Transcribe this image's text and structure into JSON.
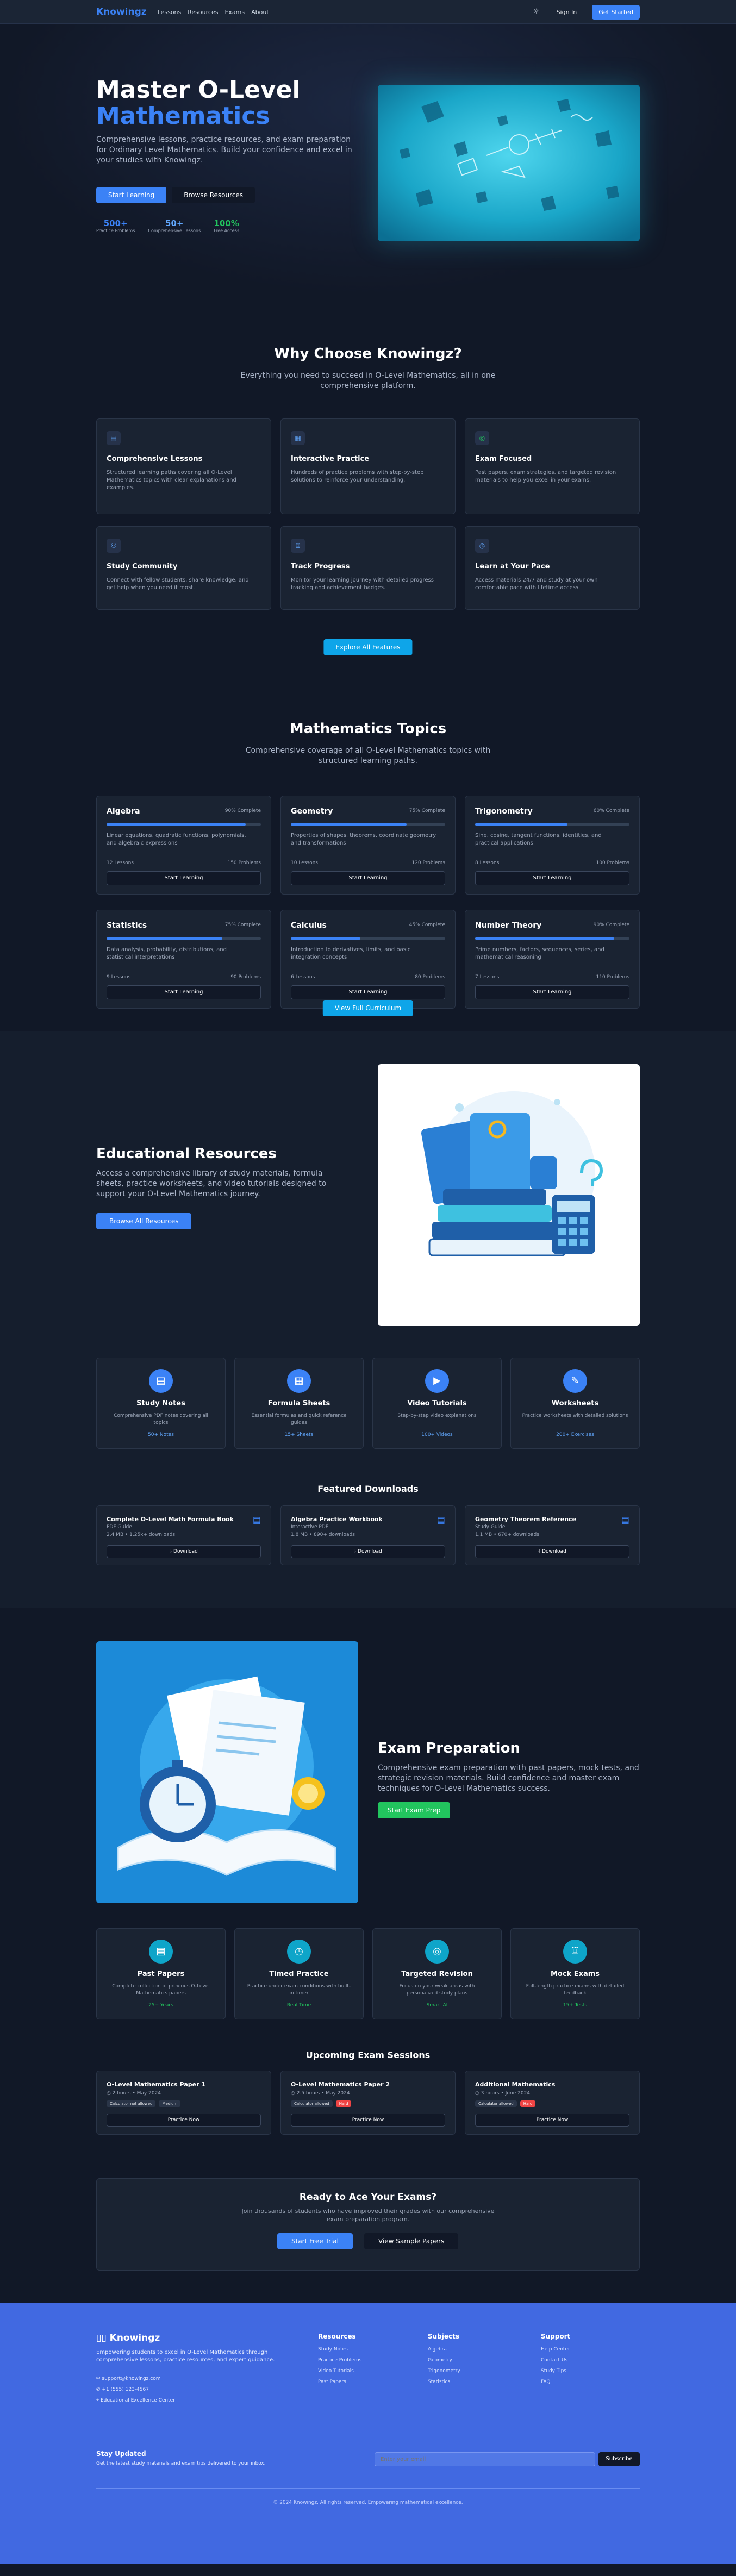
{
  "nav": {
    "logo": "Knowingz",
    "links": [
      "Lessons",
      "Resources",
      "Exams",
      "About"
    ],
    "theme_icon": "sun-icon",
    "signin": "Sign In",
    "get_started": "Get Started"
  },
  "hero": {
    "title_line1": "Master O-Level",
    "title_line2": "Mathematics",
    "subtitle": "Comprehensive lessons, practice resources, and exam preparation for Ordinary Level Mathematics. Build your confidence and excel in your studies with Knowingz.",
    "btn_primary": "Start Learning",
    "btn_secondary": "Browse Resources",
    "stats": [
      {
        "value": "500+",
        "label": "Practice Problems",
        "color": "#3b82f6"
      },
      {
        "value": "50+",
        "label": "Comprehensive Lessons",
        "color": "#60a5fa"
      },
      {
        "value": "100%",
        "label": "Free Access",
        "color": "#22c55e"
      }
    ]
  },
  "why": {
    "title": "Why Choose Knowingz?",
    "lead": "Everything you need to succeed in O-Level Mathematics, all in one comprehensive platform.",
    "features": [
      {
        "icon": "book-icon",
        "title": "Comprehensive Lessons",
        "text": "Structured learning paths covering all O-Level Mathematics topics with clear explanations and examples."
      },
      {
        "icon": "calculator-icon",
        "title": "Interactive Practice",
        "text": "Hundreds of practice problems with step-by-step solutions to reinforce your understanding."
      },
      {
        "icon": "target-icon",
        "title": "Exam Focused",
        "text": "Past papers, exam strategies, and targeted revision materials to help you excel in your exams."
      },
      {
        "icon": "users-icon",
        "title": "Study Community",
        "text": "Connect with fellow students, share knowledge, and get help when you need it most."
      },
      {
        "icon": "trophy-icon",
        "title": "Track Progress",
        "text": "Monitor your learning journey with detailed progress tracking and achievement badges."
      },
      {
        "icon": "clock-icon",
        "title": "Learn at Your Pace",
        "text": "Access materials 24/7 and study at your own comfortable pace with lifetime access."
      }
    ],
    "button": "Explore All Features"
  },
  "topics": {
    "title": "Mathematics Topics",
    "lead": "Comprehensive coverage of all O-Level Mathematics topics with structured learning paths.",
    "items": [
      {
        "name": "Algebra",
        "pct_label": "90% Complete",
        "pct": 0.9,
        "desc": "Linear equations, quadratic functions, polynomials, and algebraic expressions",
        "lessons": "12 Lessons",
        "problems": "150 Problems",
        "btn": "Start Learning"
      },
      {
        "name": "Geometry",
        "pct_label": "75% Complete",
        "pct": 0.75,
        "desc": "Properties of shapes, theorems, coordinate geometry and transformations",
        "lessons": "10 Lessons",
        "problems": "120 Problems",
        "btn": "Start Learning"
      },
      {
        "name": "Trigonometry",
        "pct_label": "60% Complete",
        "pct": 0.6,
        "desc": "Sine, cosine, tangent functions, identities, and practical applications",
        "lessons": "8 Lessons",
        "problems": "100 Problems",
        "btn": "Start Learning"
      },
      {
        "name": "Statistics",
        "pct_label": "75% Complete",
        "pct": 0.75,
        "desc": "Data analysis, probability, distributions, and statistical interpretations",
        "lessons": "9 Lessons",
        "problems": "90 Problems",
        "btn": "Start Learning"
      },
      {
        "name": "Calculus",
        "pct_label": "45% Complete",
        "pct": 0.45,
        "desc": "Introduction to derivatives, limits, and basic integration concepts",
        "lessons": "6 Lessons",
        "problems": "80 Problems",
        "btn": "Start Learning"
      },
      {
        "name": "Number Theory",
        "pct_label": "90% Complete",
        "pct": 0.9,
        "desc": "Prime numbers, factors, sequences, series, and mathematical reasoning",
        "lessons": "7 Lessons",
        "problems": "110 Problems",
        "btn": "Start Learning"
      }
    ],
    "button": "View Full Curriculum"
  },
  "resources": {
    "title": "Educational Resources",
    "lead": "Access a comprehensive library of study materials, formula sheets, practice worksheets, and video tutorials designed to support your O-Level Mathematics journey.",
    "button": "Browse All Resources",
    "cards": [
      {
        "icon": "file-icon",
        "title": "Study Notes",
        "text": "Comprehensive PDF notes covering all topics",
        "count": "50+ Notes"
      },
      {
        "icon": "calculator-icon",
        "title": "Formula Sheets",
        "text": "Essential formulas and quick reference guides",
        "count": "15+ Sheets"
      },
      {
        "icon": "video-icon",
        "title": "Video Tutorials",
        "text": "Step-by-step video explanations",
        "count": "100+ Videos"
      },
      {
        "icon": "pencil-icon",
        "title": "Worksheets",
        "text": "Practice worksheets with detailed solutions",
        "count": "200+ Exercises"
      }
    ],
    "downloads_title": "Featured Downloads",
    "downloads": [
      {
        "title": "Complete O-Level Math Formula Book",
        "type": "PDF Guide",
        "meta": "2.4 MB • 1.25k+ downloads",
        "btn": "Download"
      },
      {
        "title": "Algebra Practice Workbook",
        "type": "Interactive PDF",
        "meta": "1.8 MB • 890+ downloads",
        "btn": "Download"
      },
      {
        "title": "Geometry Theorem Reference",
        "type": "Study Guide",
        "meta": "1.1 MB • 670+ downloads",
        "btn": "Download"
      }
    ]
  },
  "exam": {
    "title": "Exam Preparation",
    "lead": "Comprehensive exam preparation with past papers, mock tests, and strategic revision materials. Build confidence and master exam techniques for O-Level Mathematics success.",
    "button": "Start Exam Prep",
    "cards": [
      {
        "icon": "file-icon",
        "title": "Past Papers",
        "text": "Complete collection of previous O-Level Mathematics papers",
        "count": "25+ Years"
      },
      {
        "icon": "clock-icon",
        "title": "Timed Practice",
        "text": "Practice under exam conditions with built-in timer",
        "count": "Real Time"
      },
      {
        "icon": "target-icon",
        "title": "Targeted Revision",
        "text": "Focus on your weak areas with personalized study plans",
        "count": "Smart AI"
      },
      {
        "icon": "trophy-icon",
        "title": "Mock Exams",
        "text": "Full-length practice exams with detailed feedback",
        "count": "15+ Tests"
      }
    ],
    "sessions_title": "Upcoming Exam Sessions",
    "sessions": [
      {
        "title": "O-Level Mathematics Paper 1",
        "meta": "2 hours • May 2024",
        "tags": [
          "Calculator not allowed",
          "Medium"
        ],
        "red": [
          false,
          false
        ],
        "btn": "Practice Now"
      },
      {
        "title": "O-Level Mathematics Paper 2",
        "meta": "2.5 hours • May 2024",
        "tags": [
          "Calculator allowed",
          "Hard"
        ],
        "red": [
          false,
          true
        ],
        "btn": "Practice Now"
      },
      {
        "title": "Additional Mathematics",
        "meta": "3 hours • June 2024",
        "tags": [
          "Calculator allowed",
          "Hard"
        ],
        "red": [
          false,
          true
        ],
        "btn": "Practice Now"
      }
    ],
    "cta_title": "Ready to Ace Your Exams?",
    "cta_text": "Join thousands of students who have improved their grades with our comprehensive exam preparation program.",
    "cta_primary": "Start Free Trial",
    "cta_secondary": "View Sample Papers"
  },
  "footer": {
    "logo": "Knowingz",
    "desc": "Empowering students to excel in O-Level Mathematics through comprehensive lessons, practice resources, and expert guidance.",
    "email": "support@knowingz.com",
    "phone": "+1 (555) 123-4567",
    "address": "Educational Excellence Center",
    "cols": [
      {
        "title": "Resources",
        "items": [
          "Study Notes",
          "Practice Problems",
          "Video Tutorials",
          "Past Papers"
        ]
      },
      {
        "title": "Subjects",
        "items": [
          "Algebra",
          "Geometry",
          "Trigonometry",
          "Statistics"
        ]
      },
      {
        "title": "Support",
        "items": [
          "Help Center",
          "Contact Us",
          "Study Tips",
          "FAQ"
        ]
      }
    ],
    "newsletter_title": "Stay Updated",
    "newsletter_text": "Get the latest study materials and exam tips delivered to your inbox.",
    "email_placeholder": "Enter your email",
    "subscribe": "Subscribe",
    "copyright": "© 2024 Knowingz. All rights reserved. Empowering mathematical excellence."
  }
}
